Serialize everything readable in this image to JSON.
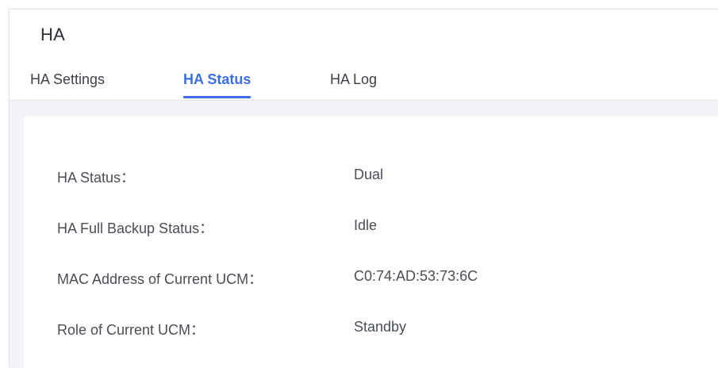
{
  "page": {
    "title": "HA"
  },
  "tabs": [
    {
      "label": "HA Settings",
      "active": false
    },
    {
      "label": "HA Status",
      "active": true
    },
    {
      "label": "HA Log",
      "active": false
    }
  ],
  "status": {
    "rows": [
      {
        "label": "HA Status：",
        "value": "Dual"
      },
      {
        "label": "HA Full Backup Status：",
        "value": "Idle"
      },
      {
        "label": "MAC Address of Current UCM：",
        "value": "C0:74:AD:53:73:6C"
      },
      {
        "label": "Role of Current UCM：",
        "value": "Standby"
      }
    ]
  },
  "colors": {
    "accent": "#3b6fe6",
    "text": "#3d4148",
    "content_bg": "#f3f4f7"
  }
}
